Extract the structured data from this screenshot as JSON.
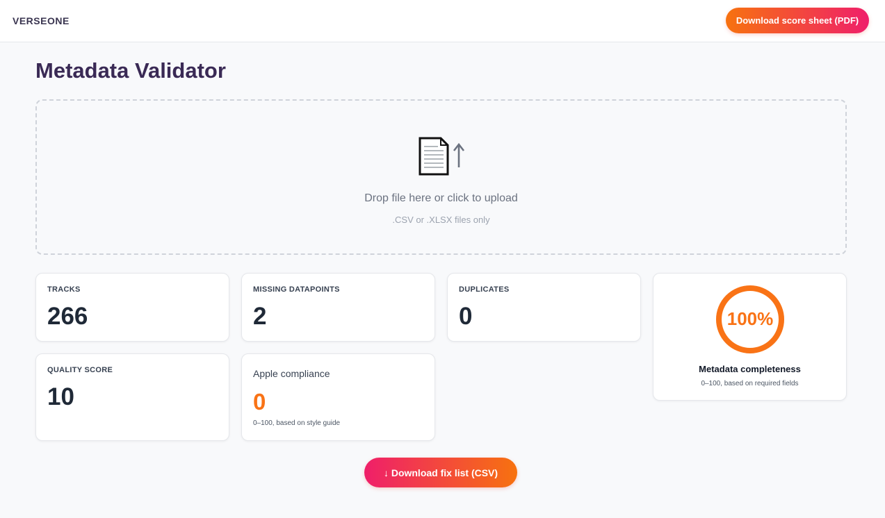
{
  "header": {
    "brand": "VERSEONE",
    "download_pdf_label": "Download score sheet (PDF)"
  },
  "page": {
    "title": "Metadata Validator"
  },
  "upload": {
    "icon": "document-upload-icon",
    "prompt": "Drop file here or click to upload",
    "hint": ".CSV or .XLSX files only"
  },
  "stats": {
    "tracks": {
      "label": "TRACKS",
      "value": "266"
    },
    "missing": {
      "label": "MISSING DATAPOINTS",
      "value": "2"
    },
    "duplicates": {
      "label": "DUPLICATES",
      "value": "0"
    },
    "quality": {
      "label": "QUALITY SCORE",
      "value": "10"
    },
    "apple": {
      "label": "Apple compliance",
      "value": "0",
      "note": "0–100, based on style guide"
    }
  },
  "completeness": {
    "percent_text": "100%",
    "fraction": 1.0,
    "title": "Metadata completeness",
    "note": "0–100, based on required fields"
  },
  "footer": {
    "download_csv_label": "↓ Download fix list (CSV)"
  },
  "colors": {
    "accent_orange": "#f97316",
    "accent_pink": "#ef1f6a",
    "title_purple": "#3a2a55"
  }
}
